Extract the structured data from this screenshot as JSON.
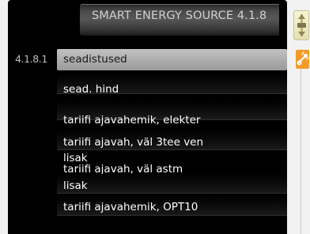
{
  "header": {
    "title": "SMART ENERGY SOURCE 4.1.8"
  },
  "menu": {
    "selected_number": "4.1.8.1",
    "items": [
      {
        "label": "seadistused"
      },
      {
        "label": "sead. hind"
      },
      {
        "label": "tariifi ajavahemik, elekter"
      },
      {
        "label": "tariifi ajavah, väl 3tee ven lisak"
      },
      {
        "label": "tariifi ajavah, väl astm lisak"
      },
      {
        "label": "tariifi ajavahemik, OPT10"
      }
    ],
    "item_lines": {
      "item3_line1": "tariifi ajavah, väl 3tee ven",
      "item3_line2": "lisak",
      "item4_line1": "tariifi ajavah, väl astm",
      "item4_line2": "lisak"
    }
  },
  "scrollbar": {
    "cap_icon": "scroll-up-icon",
    "thumb_icon": "settings-icon",
    "accent_color": "#f39b2a"
  }
}
